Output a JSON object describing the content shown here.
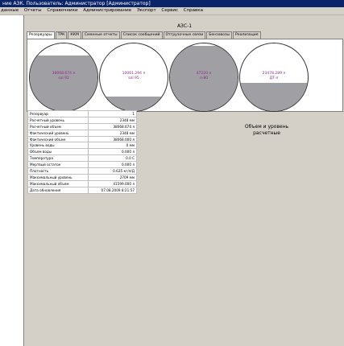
{
  "window": {
    "title": "ние АЗК. Пользователь: Администратор [Администратор]"
  },
  "menu": [
    "данные",
    "Отчеты",
    "Справочники",
    "Администрирование",
    "Экспорт",
    "Сервис",
    "Справка"
  ],
  "station": "АЗС-1",
  "tabs": [
    "Резервуары",
    "ТРК",
    "ККМ",
    "Сменные отчеты",
    "Список сообщений",
    "Отгрузочные связи",
    "Бензовозы",
    "Реализация"
  ],
  "tanks": [
    {
      "line1": "38068.674 л",
      "line2": "sol 92",
      "fill": 0.82
    },
    {
      "line1": "10061.294 л",
      "line2": "sol 95",
      "fill": 0.22
    },
    {
      "line1": "47220 л",
      "line2": "л-80",
      "fill": 0.97
    },
    {
      "line1": "23478.289 л",
      "line2": "ДТ-л",
      "fill": 0.42
    }
  ],
  "info": [
    {
      "label": "Резервуар",
      "value": "1"
    },
    {
      "label": "Расчетный уровень",
      "value": "2348 мм"
    },
    {
      "label": "Расчетный объем",
      "value": "38068.674 л"
    },
    {
      "label": "Фактический уровень",
      "value": "2348 мм"
    },
    {
      "label": "Фактический объем",
      "value": "38068.000 л"
    },
    {
      "label": "Уровень воды",
      "value": "0 мм"
    },
    {
      "label": "Объем воды",
      "value": "0.000 л"
    },
    {
      "label": "Температура",
      "value": "0.0 С"
    },
    {
      "label": "Мертвый остаток",
      "value": "0.000 л"
    },
    {
      "label": "Плотность",
      "value": "0.625 кг/л/Д"
    },
    {
      "label": "Максимальный уровень",
      "value": "2709 мм"
    },
    {
      "label": "Максимальный объем",
      "value": "41599.000 л"
    },
    {
      "label": "Дата обновления",
      "value": "07.08.2009 8:21:57"
    }
  ],
  "calc_note": {
    "line1": "Объем и уровень",
    "line2": "расчетные"
  },
  "colors": {
    "title_bg": "#0a246a",
    "tank_fill": "#a0a0a4",
    "tank_label": "#8a2a8a"
  }
}
